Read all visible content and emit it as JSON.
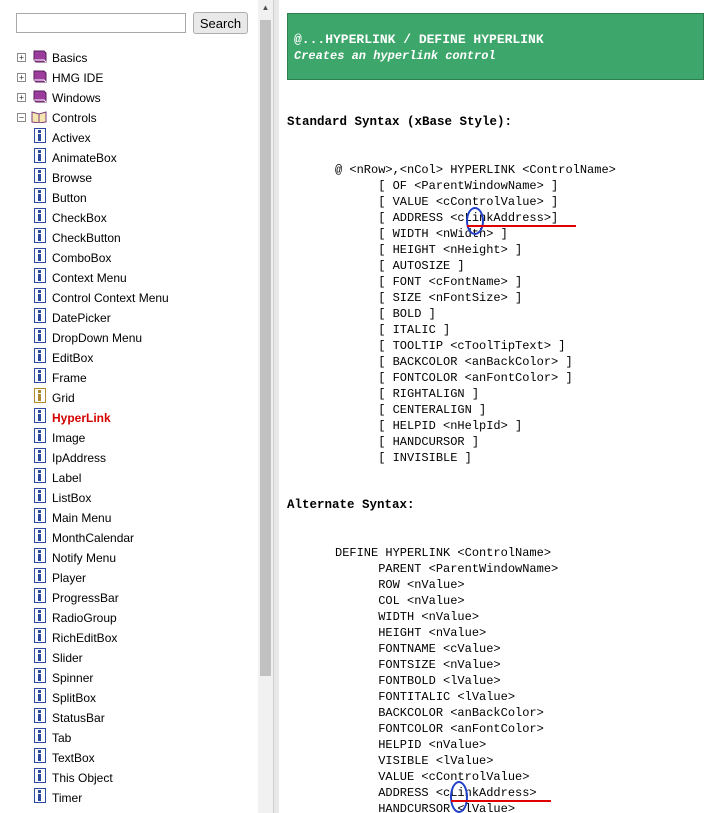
{
  "search": {
    "value": "",
    "placeholder": "",
    "button_label": "Search"
  },
  "tree": {
    "folders": [
      {
        "label": "Basics",
        "toggle": "+",
        "icon": "book-icon"
      },
      {
        "label": "HMG IDE",
        "toggle": "+",
        "icon": "book-icon"
      },
      {
        "label": "Windows",
        "toggle": "+",
        "icon": "book-icon"
      },
      {
        "label": "Controls",
        "toggle": "−",
        "icon": "open-book-icon"
      }
    ],
    "controls": [
      "Activex",
      "AnimateBox",
      "Browse",
      "Button",
      "CheckBox",
      "CheckButton",
      "ComboBox",
      "Context Menu",
      "Control Context Menu",
      "DatePicker",
      "DropDown Menu",
      "EditBox",
      "Frame",
      "Grid",
      "HyperLink",
      "Image",
      "IpAddress",
      "Label",
      "ListBox",
      "Main Menu",
      "MonthCalendar",
      "Notify Menu",
      "Player",
      "ProgressBar",
      "RadioGroup",
      "RichEditBox",
      "Slider",
      "Spinner",
      "SplitBox",
      "StatusBar",
      "Tab",
      "TextBox",
      "This Object",
      "Timer"
    ],
    "active_item": "HyperLink"
  },
  "doc": {
    "title": "@...HYPERLINK / DEFINE HYPERLINK",
    "subtitle": "Creates an hyperlink control",
    "standard_heading": "Standard Syntax (xBase Style):",
    "standard_lines": [
      "@ <nRow>,<nCol> HYPERLINK <ControlName>",
      "      [ OF <ParentWindowName> ]",
      "      [ VALUE <cControlValue> ]",
      "      [ ADDRESS <cLinkAddress>]",
      "      [ WIDTH <nWidth> ]",
      "      [ HEIGHT <nHeight> ]",
      "      [ AUTOSIZE ]",
      "      [ FONT <cFontName> ]",
      "      [ SIZE <nFontSize> ]",
      "      [ BOLD ]",
      "      [ ITALIC ]",
      "      [ TOOLTIP <cToolTipText> ]",
      "      [ BACKCOLOR <anBackColor> ]",
      "      [ FONTCOLOR <anFontColor> ]",
      "      [ RIGHTALIGN ]",
      "      [ CENTERALIGN ]",
      "      [ HELPID <nHelpId> ]",
      "      [ HANDCURSOR ]",
      "      [ INVISIBLE ]"
    ],
    "alternate_heading": "Alternate Syntax:",
    "alternate_lines": [
      "DEFINE HYPERLINK <ControlName>",
      "      PARENT <ParentWindowName>",
      "      ROW <nValue>",
      "      COL <nValue>",
      "      WIDTH <nValue>",
      "      HEIGHT <nValue>",
      "      FONTNAME <cValue>",
      "      FONTSIZE <nValue>",
      "      FONTBOLD <lValue>",
      "      FONTITALIC <lValue>",
      "      BACKCOLOR <anBackColor>",
      "      FONTCOLOR <anFontColor>",
      "      HELPID <nValue>",
      "      VISIBLE <lValue>",
      "      VALUE <cControlValue>",
      "      ADDRESS <cLinkAddress>",
      "      HANDCURSOR <lValue>"
    ]
  },
  "colors": {
    "banner": "#3da66a",
    "active_item": "#d50000",
    "annotation_line": "#e00000",
    "annotation_oval": "#2040c8"
  }
}
